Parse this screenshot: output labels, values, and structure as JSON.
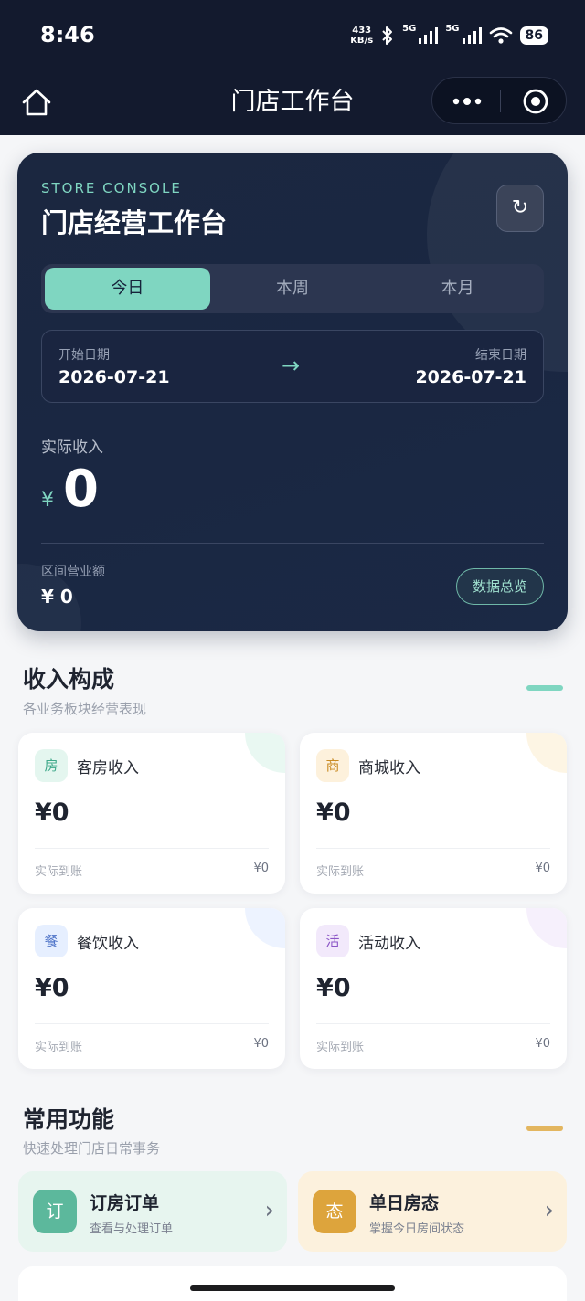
{
  "status_bar": {
    "time": "8:46",
    "net_speed_top": "433",
    "net_speed_unit": "KB/s",
    "signal_1": "5G",
    "signal_2": "5G",
    "battery": "86"
  },
  "nav": {
    "title": "门店工作台"
  },
  "hero": {
    "eyebrow": "STORE CONSOLE",
    "title": "门店经营工作台",
    "tabs": [
      {
        "label": "今日",
        "active": true
      },
      {
        "label": "本周",
        "active": false
      },
      {
        "label": "本月",
        "active": false
      }
    ],
    "start_label": "开始日期",
    "start_date": "2026-07-21",
    "end_label": "结束日期",
    "end_date": "2026-07-21",
    "arrow": "→",
    "income_label": "实际收入",
    "currency": "¥",
    "income_value": "0",
    "range_label": "区间营业额",
    "range_value": "¥ 0",
    "overview_label": "数据总览",
    "accent_color": "#7fd6c1"
  },
  "income_section": {
    "title": "收入构成",
    "subtitle": "各业务板块经营表现",
    "cards": [
      {
        "badge": "房",
        "name": "客房收入",
        "amount": "¥0",
        "foot_label": "实际到账",
        "foot_value": "¥0",
        "badge_bg": "#e4f6ef",
        "badge_fg": "#3fa98a",
        "blob": "#e9f8f2"
      },
      {
        "badge": "商",
        "name": "商城收入",
        "amount": "¥0",
        "foot_label": "实际到账",
        "foot_value": "¥0",
        "badge_bg": "#fdf1dc",
        "badge_fg": "#c98a22",
        "blob": "#fdf5e4"
      },
      {
        "badge": "餐",
        "name": "餐饮收入",
        "amount": "¥0",
        "foot_label": "实际到账",
        "foot_value": "¥0",
        "badge_bg": "#e6efff",
        "badge_fg": "#4f74c8",
        "blob": "#edf3ff"
      },
      {
        "badge": "活",
        "name": "活动收入",
        "amount": "¥0",
        "foot_label": "实际到账",
        "foot_value": "¥0",
        "badge_bg": "#f2e9fb",
        "badge_fg": "#8b55c6",
        "blob": "#f6f0fc"
      }
    ]
  },
  "functions_section": {
    "title": "常用功能",
    "subtitle": "快速处理门店日常事务",
    "items": [
      {
        "icon": "订",
        "title": "订房订单",
        "subtitle": "查看与处理订单",
        "icon_bg": "#5cb89c",
        "card_bg": "#e7f5ef"
      },
      {
        "icon": "态",
        "title": "单日房态",
        "subtitle": "掌握今日房间状态",
        "icon_bg": "#dda43c",
        "card_bg": "#fcf1dd"
      }
    ]
  }
}
